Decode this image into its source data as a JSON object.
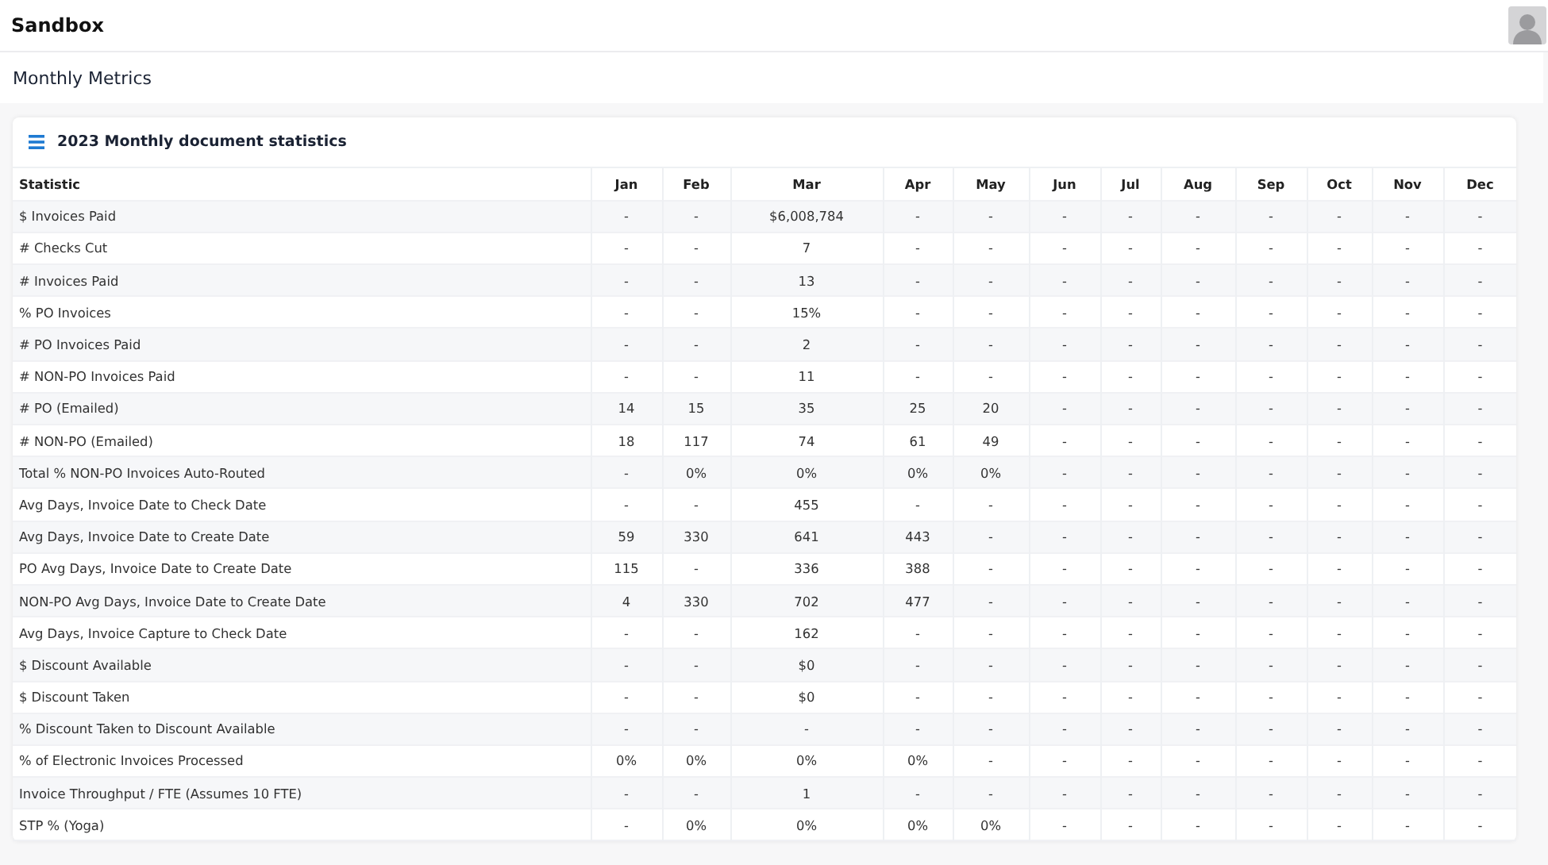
{
  "app": {
    "title": "Sandbox"
  },
  "page": {
    "title": "Monthly Metrics"
  },
  "card": {
    "title": "2023 Monthly document statistics"
  },
  "table": {
    "columns": [
      "Statistic",
      "Jan",
      "Feb",
      "Mar",
      "Apr",
      "May",
      "Jun",
      "Jul",
      "Aug",
      "Sep",
      "Oct",
      "Nov",
      "Dec"
    ],
    "rows": [
      {
        "statistic": "$ Invoices Paid",
        "values": [
          "-",
          "-",
          "$6,008,784",
          "-",
          "-",
          "-",
          "-",
          "-",
          "-",
          "-",
          "-",
          "-"
        ]
      },
      {
        "statistic": "# Checks Cut",
        "values": [
          "-",
          "-",
          "7",
          "-",
          "-",
          "-",
          "-",
          "-",
          "-",
          "-",
          "-",
          "-"
        ]
      },
      {
        "statistic": "# Invoices Paid",
        "values": [
          "-",
          "-",
          "13",
          "-",
          "-",
          "-",
          "-",
          "-",
          "-",
          "-",
          "-",
          "-"
        ]
      },
      {
        "statistic": "% PO Invoices",
        "values": [
          "-",
          "-",
          "15%",
          "-",
          "-",
          "-",
          "-",
          "-",
          "-",
          "-",
          "-",
          "-"
        ]
      },
      {
        "statistic": "# PO Invoices Paid",
        "values": [
          "-",
          "-",
          "2",
          "-",
          "-",
          "-",
          "-",
          "-",
          "-",
          "-",
          "-",
          "-"
        ]
      },
      {
        "statistic": "# NON-PO Invoices Paid",
        "values": [
          "-",
          "-",
          "11",
          "-",
          "-",
          "-",
          "-",
          "-",
          "-",
          "-",
          "-",
          "-"
        ]
      },
      {
        "statistic": "# PO (Emailed)",
        "values": [
          "14",
          "15",
          "35",
          "25",
          "20",
          "-",
          "-",
          "-",
          "-",
          "-",
          "-",
          "-"
        ]
      },
      {
        "statistic": "# NON-PO (Emailed)",
        "values": [
          "18",
          "117",
          "74",
          "61",
          "49",
          "-",
          "-",
          "-",
          "-",
          "-",
          "-",
          "-"
        ]
      },
      {
        "statistic": "Total % NON-PO Invoices Auto-Routed",
        "values": [
          "-",
          "0%",
          "0%",
          "0%",
          "0%",
          "-",
          "-",
          "-",
          "-",
          "-",
          "-",
          "-"
        ]
      },
      {
        "statistic": "Avg Days, Invoice Date to Check Date",
        "values": [
          "-",
          "-",
          "455",
          "-",
          "-",
          "-",
          "-",
          "-",
          "-",
          "-",
          "-",
          "-"
        ]
      },
      {
        "statistic": "Avg Days, Invoice Date to Create Date",
        "values": [
          "59",
          "330",
          "641",
          "443",
          "-",
          "-",
          "-",
          "-",
          "-",
          "-",
          "-",
          "-"
        ]
      },
      {
        "statistic": "PO Avg Days, Invoice Date to Create Date",
        "values": [
          "115",
          "-",
          "336",
          "388",
          "-",
          "-",
          "-",
          "-",
          "-",
          "-",
          "-",
          "-"
        ]
      },
      {
        "statistic": "NON-PO Avg Days, Invoice Date to Create Date",
        "values": [
          "4",
          "330",
          "702",
          "477",
          "-",
          "-",
          "-",
          "-",
          "-",
          "-",
          "-",
          "-"
        ]
      },
      {
        "statistic": "Avg Days, Invoice Capture to Check Date",
        "values": [
          "-",
          "-",
          "162",
          "-",
          "-",
          "-",
          "-",
          "-",
          "-",
          "-",
          "-",
          "-"
        ]
      },
      {
        "statistic": "$ Discount Available",
        "values": [
          "-",
          "-",
          "$0",
          "-",
          "-",
          "-",
          "-",
          "-",
          "-",
          "-",
          "-",
          "-"
        ]
      },
      {
        "statistic": "$ Discount Taken",
        "values": [
          "-",
          "-",
          "$0",
          "-",
          "-",
          "-",
          "-",
          "-",
          "-",
          "-",
          "-",
          "-"
        ]
      },
      {
        "statistic": "% Discount Taken to Discount Available",
        "values": [
          "-",
          "-",
          "-",
          "-",
          "-",
          "-",
          "-",
          "-",
          "-",
          "-",
          "-",
          "-"
        ]
      },
      {
        "statistic": "% of Electronic Invoices Processed",
        "values": [
          "0%",
          "0%",
          "0%",
          "0%",
          "-",
          "-",
          "-",
          "-",
          "-",
          "-",
          "-",
          "-"
        ]
      },
      {
        "statistic": "Invoice Throughput / FTE (Assumes 10 FTE)",
        "values": [
          "-",
          "-",
          "1",
          "-",
          "-",
          "-",
          "-",
          "-",
          "-",
          "-",
          "-",
          "-"
        ]
      },
      {
        "statistic": "STP % (Yoga)",
        "values": [
          "-",
          "0%",
          "0%",
          "0%",
          "0%",
          "-",
          "-",
          "-",
          "-",
          "-",
          "-",
          "-"
        ]
      }
    ]
  }
}
